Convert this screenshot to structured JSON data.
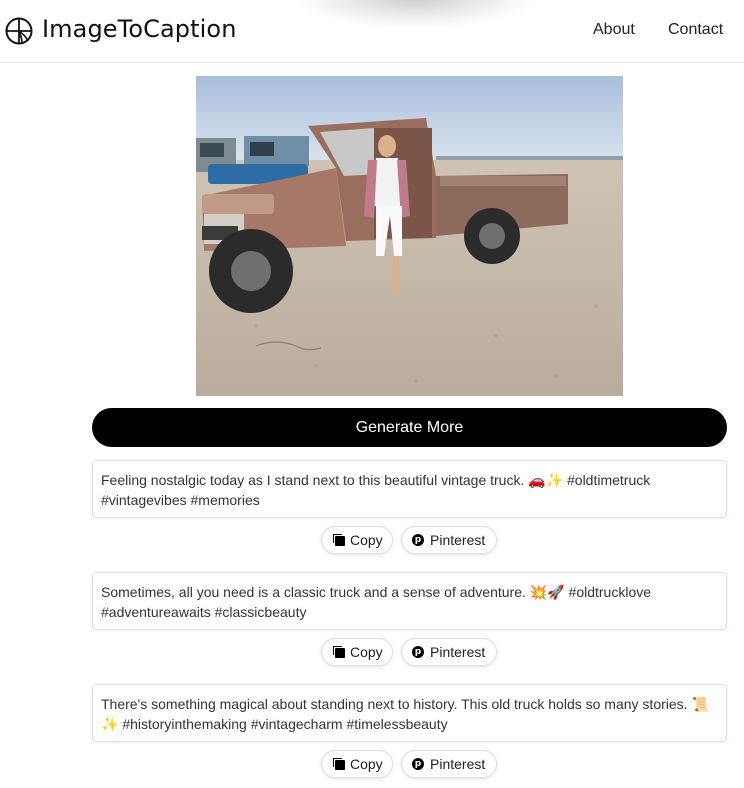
{
  "header": {
    "brand": "ImageToCaption",
    "nav": [
      {
        "label": "About"
      },
      {
        "label": "Contact"
      }
    ]
  },
  "photo": {
    "description": "woman standing beside a rusty vintage pickup truck on a sandy beach"
  },
  "generate_label": "Generate More",
  "captions": [
    {
      "text": "Feeling nostalgic today as I stand next to this beautiful vintage truck. 🚗✨ #oldtimetruck #vintagevibes #memories",
      "copy_label": "Copy",
      "pinterest_label": "Pinterest"
    },
    {
      "text": "Sometimes, all you need is a classic truck and a sense of adventure. 💥🚀 #oldtrucklove #adventureawaits #classicbeauty",
      "copy_label": "Copy",
      "pinterest_label": "Pinterest"
    },
    {
      "text": "There's something magical about standing next to history. This old truck holds so many stories. 📜✨ #historyinthemaking #vintagecharm #timelessbeauty",
      "copy_label": "Copy",
      "pinterest_label": "Pinterest"
    }
  ],
  "colors": {
    "primary_button": "#000000",
    "text": "#333333",
    "border": "#dcdcdc"
  },
  "icons": {
    "logo": "globe-logo-icon",
    "copy": "copy-icon",
    "pinterest": "pinterest-icon"
  }
}
